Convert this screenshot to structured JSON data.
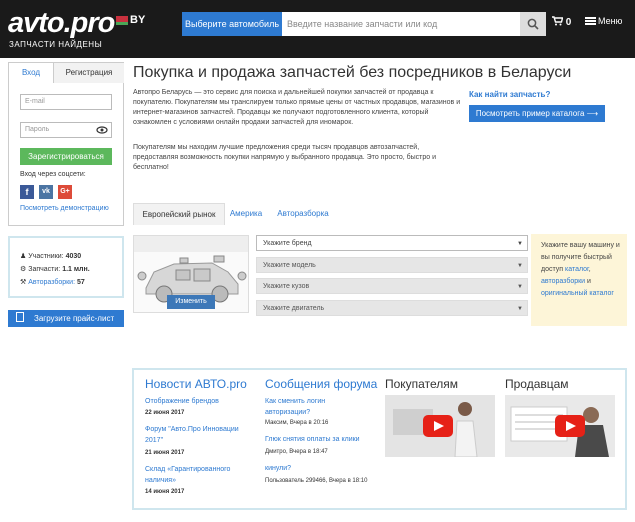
{
  "header": {
    "logo_text": "avto.pro",
    "logo_country": "BY",
    "logo_subtitle": "ЗАПЧАСТИ НАЙДЕНЫ",
    "select_car_label": "Выберите автомобиль",
    "search_placeholder": "Введите название запчасти или код",
    "cart_count": "0",
    "menu_label": "Меню"
  },
  "auth": {
    "tab_login": "Вход",
    "tab_register": "Регистрация",
    "email_placeholder": "E-mail",
    "password_placeholder": "Пароль",
    "register_button": "Зарегистрироваться",
    "social_label": "Вход через соцсети:",
    "demo_link": "Посмотреть демонстрацию"
  },
  "stats": {
    "members_label": "Участники:",
    "members_value": "4030",
    "parts_label": "Запчасти:",
    "parts_value": "1.1 млн.",
    "dismantlers_label": "Авторазборки:",
    "dismantlers_value": "57"
  },
  "upload_button": "Загрузите прайс-лист",
  "main": {
    "title": "Покупка и продажа запчастей без посредников в Беларуси",
    "paragraph1": "Автопро Беларусь — это сервис для поиска и дальнейшей покупки запчастей от продавца к покупателю. Покупателям мы транслируем только прямые цены от частных продавцов, магазинов и интернет-магазинов запчастей. Продавцы же получают подготовленного клиента, который ознакомлен с условиями онлайн продажи запчастей для иномарок.",
    "paragraph2": "Покупателям мы находим лучшие предложения среди тысяч продавцов автозапчастей, предоставляя возможность покупки напрямую у выбранного продавца. Это просто, быстро и бесплатно!",
    "howto_link": "Как найти запчасть?",
    "catalog_button": "Посмотреть пример каталога ⟶"
  },
  "market_tabs": [
    "Европейский рынок",
    "Америка",
    "Авторазборка"
  ],
  "selector": {
    "change_button": "Изменить",
    "brand": "Укажите бренд",
    "model": "Укажите модель",
    "body": "Укажите кузов",
    "engine": "Укажите двигатель",
    "note_text": "Укажите вашу машину и вы получите быстрый доступ",
    "note_link1": "каталог",
    "note_sep": ",",
    "note_link2": "авторазборки",
    "note_and": "и",
    "note_link3": "оригинальный каталог"
  },
  "news": {
    "heading": "Новости АВТО.pro",
    "items": [
      {
        "title": "Отображение брендов",
        "date": "22 июня 2017"
      },
      {
        "title": "Форум \"Авто.Про Инновации 2017\"",
        "date": "21 июня 2017"
      },
      {
        "title": "Склад «Гарантированного наличия»",
        "date": "14 июня 2017"
      }
    ]
  },
  "forum": {
    "heading": "Сообщения форума",
    "items": [
      {
        "title": "Как сменить логин авторизации?",
        "meta": "Максим, Вчера в 20:16"
      },
      {
        "title": "Глюк снятия оплаты за клики",
        "meta": "Дмитро, Вчера в 18:47"
      },
      {
        "title": "кинули?",
        "meta": "Пользователь 299466, Вчера в 18:10"
      }
    ]
  },
  "buyers_heading": "Покупателям",
  "sellers_heading": "Продавцам",
  "colors": {
    "accent": "#2e7ad1",
    "green": "#5cb85c",
    "header_bg": "#1a1a1a",
    "note_bg": "#fdf5d8",
    "youtube_red": "#e62117"
  }
}
